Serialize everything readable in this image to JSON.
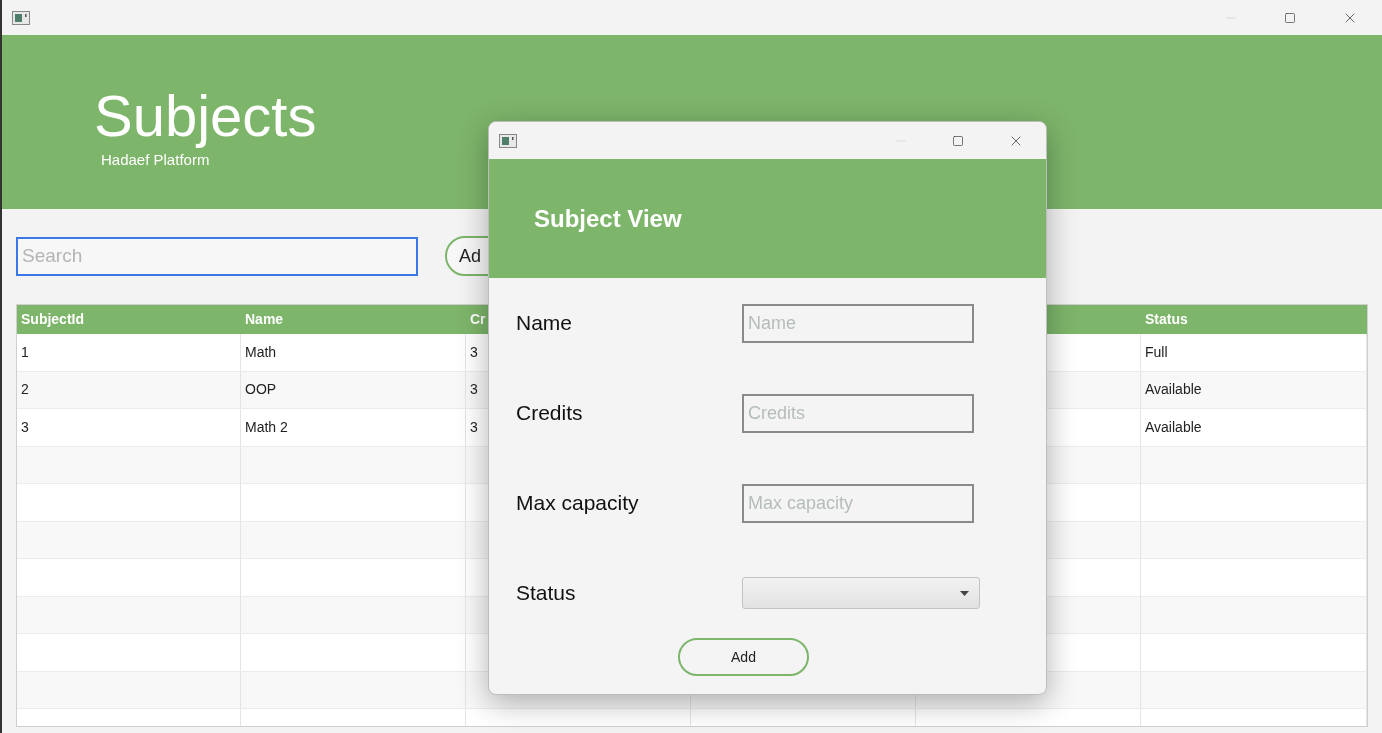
{
  "header": {
    "title": "Subjects",
    "subtitle": "Hadaef Platform"
  },
  "toolbar": {
    "search": {
      "placeholder": "Search"
    },
    "add_button": "Ad"
  },
  "table": {
    "columns": [
      "SubjectId",
      "Name",
      "Cr",
      "Status"
    ],
    "rows": [
      [
        "1",
        "Math",
        "3",
        "Full"
      ],
      [
        "2",
        "OOP",
        "3",
        "Available"
      ],
      [
        "3",
        "Math 2",
        "3",
        "Available"
      ]
    ]
  },
  "dialog": {
    "title": "Subject View",
    "fields": [
      {
        "kind": "text",
        "label": "Name",
        "placeholder": "Name"
      },
      {
        "kind": "text",
        "label": "Credits",
        "placeholder": "Credits"
      },
      {
        "kind": "text",
        "label": "Max capacity",
        "placeholder": "Max capacity"
      },
      {
        "kind": "select",
        "label": "Status"
      }
    ],
    "button": "Add"
  }
}
